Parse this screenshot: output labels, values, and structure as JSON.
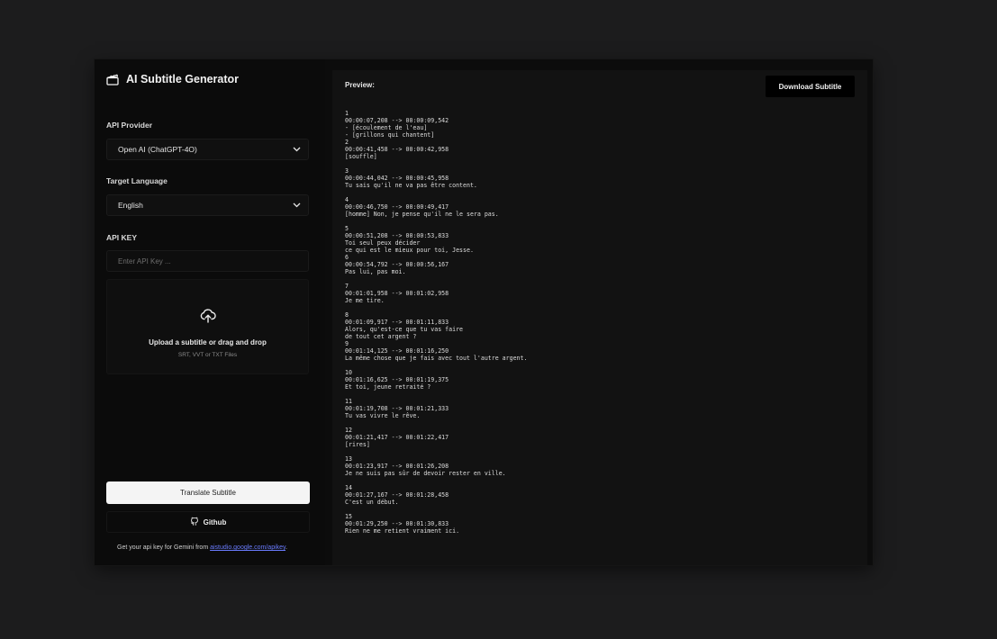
{
  "app": {
    "title": "AI Subtitle Generator"
  },
  "sidebar": {
    "api_provider": {
      "label": "API Provider",
      "value": "Open AI (ChatGPT-4O)"
    },
    "target_language": {
      "label": "Target Language",
      "value": "English"
    },
    "api_key": {
      "label": "API KEY",
      "placeholder": "Enter API Key ..."
    },
    "upload": {
      "title": "Upload a subtitle or drag and drop",
      "subtitle": "SRT, VVT or TXT Files"
    },
    "translate_label": "Translate Subtitle",
    "github_label": "Github",
    "footnote": {
      "text": "Get your api key for Gemini from ",
      "link": "aistudio.google.com/apikey",
      "end": "."
    }
  },
  "preview": {
    "label": "Preview:",
    "download_label": "Download Subtitle",
    "cues": [
      {
        "index": "1",
        "time": "00:00:07,208 --> 00:00:09,542",
        "lines": [
          "- [écoulement de l'eau]",
          "- [grillons qui chantent]"
        ]
      },
      {
        "index": "2",
        "time": "00:00:41,458 --> 00:00:42,958",
        "lines": [
          "[souffle]"
        ]
      },
      {
        "index": "3",
        "time": "00:00:44,042 --> 00:00:45,958",
        "lines": [
          "Tu sais qu'il ne va pas être content."
        ]
      },
      {
        "index": "4",
        "time": "00:00:46,750 --> 00:00:49,417",
        "lines": [
          "[homme] Non, je pense qu'il ne le sera pas."
        ]
      },
      {
        "index": "5",
        "time": "00:00:51,208 --> 00:00:53,833",
        "lines": [
          "Toi seul peux décider",
          "ce qui est le mieux pour toi, Jesse."
        ]
      },
      {
        "index": "6",
        "time": "00:00:54,792 --> 00:00:56,167",
        "lines": [
          "Pas lui, pas moi."
        ]
      },
      {
        "index": "7",
        "time": "00:01:01,958 --> 00:01:02,958",
        "lines": [
          "Je me tire."
        ]
      },
      {
        "index": "8",
        "time": "00:01:09,917 --> 00:01:11,833",
        "lines": [
          "Alors, qu'est-ce que tu vas faire",
          "de tout cet argent ?"
        ]
      },
      {
        "index": "9",
        "time": "00:01:14,125 --> 00:01:16,250",
        "lines": [
          "La même chose que je fais avec tout l'autre argent."
        ]
      },
      {
        "index": "10",
        "time": "00:01:16,625 --> 00:01:19,375",
        "lines": [
          "Et toi, jeune retraité ?"
        ]
      },
      {
        "index": "11",
        "time": "00:01:19,708 --> 00:01:21,333",
        "lines": [
          "Tu vas vivre le rêve."
        ]
      },
      {
        "index": "12",
        "time": "00:01:21,417 --> 00:01:22,417",
        "lines": [
          "[rires]"
        ]
      },
      {
        "index": "13",
        "time": "00:01:23,917 --> 00:01:26,208",
        "lines": [
          "Je ne suis pas sûr de devoir rester en ville."
        ]
      },
      {
        "index": "14",
        "time": "00:01:27,167 --> 00:01:28,458",
        "lines": [
          "C'est un début."
        ]
      },
      {
        "index": "15",
        "time": "00:01:29,250 --> 00:01:30,833",
        "lines": [
          "Rien ne me retient vraiment ici."
        ]
      }
    ]
  },
  "icons": {
    "brand": "clapperboard-icon",
    "chevron": "chevron-down-icon",
    "upload": "cloud-upload-icon",
    "github": "github-icon"
  }
}
